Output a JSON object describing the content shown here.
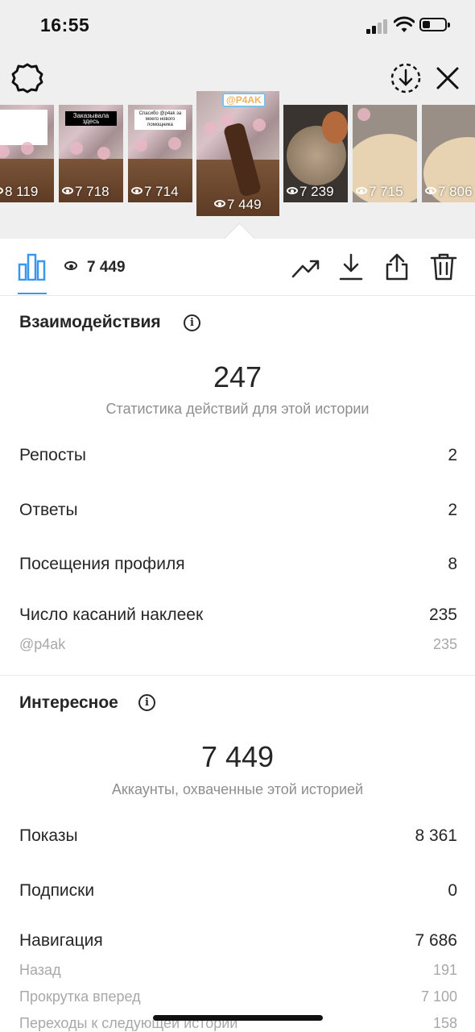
{
  "status_bar": {
    "time": "16:55"
  },
  "stories": [
    {
      "views": "8 119"
    },
    {
      "views": "7 718",
      "caption": "Заказывала здесь"
    },
    {
      "views": "7 714",
      "caption": "Спасибо @p4ak за моего нового помощника"
    },
    {
      "views": "7 449",
      "brand": "@P4AK",
      "selected": true
    },
    {
      "views": "7 239"
    },
    {
      "views": "7 715"
    },
    {
      "views": "7 806"
    }
  ],
  "toolbar": {
    "views_count": "7 449"
  },
  "interactions": {
    "title": "Взаимодействия",
    "total": "247",
    "subtitle": "Статистика действий для этой истории",
    "rows": [
      {
        "label": "Репосты",
        "value": "2"
      },
      {
        "label": "Ответы",
        "value": "2"
      },
      {
        "label": "Посещения профиля",
        "value": "8"
      },
      {
        "label": "Число касаний наклеек",
        "value": "235"
      }
    ],
    "sticker_sub": {
      "label": "@p4ak",
      "value": "235"
    }
  },
  "discovery": {
    "title": "Интересное",
    "total": "7 449",
    "subtitle": "Аккаунты, охваченные этой историей",
    "rows": [
      {
        "label": "Показы",
        "value": "8 361"
      },
      {
        "label": "Подписки",
        "value": "0"
      },
      {
        "label": "Навигация",
        "value": "7 686"
      }
    ],
    "navigation_sub": [
      {
        "label": "Назад",
        "value": "191"
      },
      {
        "label": "Прокрутка вперед",
        "value": "7 100"
      },
      {
        "label": "Переходы к следующей истории",
        "value": "158"
      }
    ]
  },
  "colors": {
    "accent": "#3897f0",
    "text": "#262626",
    "muted": "#8e8e8e"
  }
}
